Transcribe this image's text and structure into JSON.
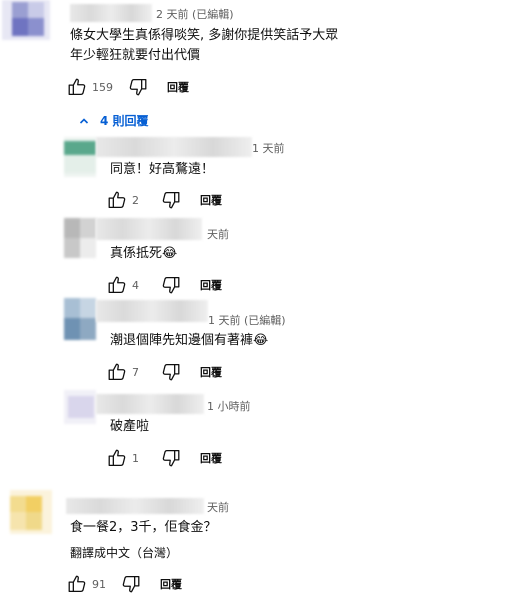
{
  "comments": [
    {
      "time": "2 天前 (已編輯)",
      "lines": [
        "條女大學生真係得啖笑, 多謝你提供笑話予大眾",
        "年少輕狂就要付出代價"
      ],
      "likes": "159",
      "reply_label": "回覆",
      "replies_toggle": "4 則回覆"
    }
  ],
  "replies": [
    {
      "time": "1 天前",
      "text": "同意！好高鶩遠！",
      "likes": "2",
      "reply_label": "回覆"
    },
    {
      "time": "天前",
      "text": "真係抵死😂",
      "likes": "4",
      "reply_label": "回覆"
    },
    {
      "time": "1 天前 (已編輯)",
      "text": "潮退個陣先知邊個有著褲😂",
      "likes": "7",
      "reply_label": "回覆"
    },
    {
      "time": "1 小時前",
      "text": "破產啦",
      "likes": "1",
      "reply_label": "回覆"
    }
  ],
  "comment2": {
    "time": "天前",
    "text": "食一餐2，3千，佢食金？",
    "translate": "翻譯成中文（台灣）",
    "likes": "91",
    "reply_label": "回覆"
  },
  "icons": {
    "like": "thumbs-up-icon",
    "dislike": "thumbs-down-icon",
    "chevron": "chevron-up-icon"
  },
  "colors": {
    "link_blue": "#065fd4",
    "secondary_text": "#606060"
  }
}
